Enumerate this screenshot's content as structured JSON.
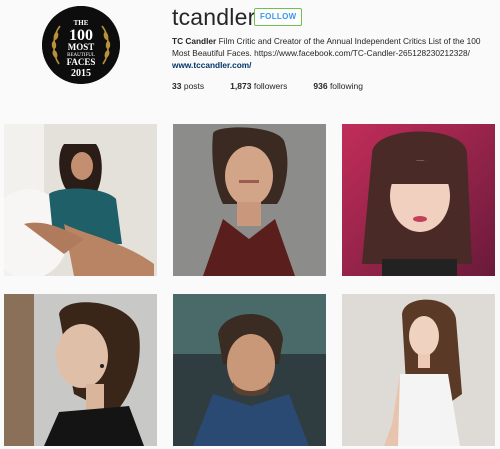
{
  "profile": {
    "username": "tcandler",
    "follow_label": "FOLLOW",
    "avatar_text": {
      "line1": "THE",
      "line2": "100",
      "line3": "MOST",
      "line4": "BEAUTIFUL",
      "line5": "FACES",
      "line6": "2015"
    },
    "bio_name": "TC Candler",
    "bio_text": "Film Critic and Creator of the Annual Independent Critics List of the 100 Most Beautiful Faces. https://www.facebook.com/TC-Candler-265128230212328/",
    "bio_link": "www.tccandler.com/"
  },
  "stats": {
    "posts_count": "33",
    "posts_label": "posts",
    "followers_count": "1,873",
    "followers_label": "followers",
    "following_count": "936",
    "following_label": "following"
  },
  "posts": [
    {
      "name": "post-1",
      "bg": "#e8e3dc",
      "accent": "#1d5a63"
    },
    {
      "name": "post-2",
      "bg": "#8a8a88",
      "accent": "#5a1f1c"
    },
    {
      "name": "post-3",
      "bg": "#a3274b",
      "accent": "#4a2c2a"
    },
    {
      "name": "post-4",
      "bg": "#c9c9c9",
      "accent": "#1a1410"
    },
    {
      "name": "post-5",
      "bg": "#2c3b3f",
      "accent": "#1f3e6a"
    },
    {
      "name": "post-6",
      "bg": "#dedbd6",
      "accent": "#f2f2f2"
    }
  ],
  "colors": {
    "link": "#003569",
    "follow_border": "#70c050",
    "follow_text": "#3897f0"
  }
}
